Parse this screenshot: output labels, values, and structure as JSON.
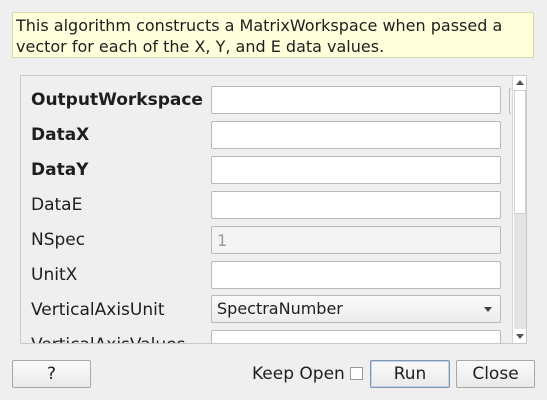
{
  "description": "This algorithm constructs a MatrixWorkspace when passed a\nvector for each of the X, Y, and E data values.",
  "properties": [
    {
      "label": "OutputWorkspace",
      "required": true,
      "value": ""
    },
    {
      "label": "DataX",
      "required": true,
      "value": ""
    },
    {
      "label": "DataY",
      "required": true,
      "value": ""
    },
    {
      "label": "DataE",
      "required": false,
      "value": ""
    },
    {
      "label": "NSpec",
      "required": false,
      "value": "",
      "placeholder": "1"
    },
    {
      "label": "UnitX",
      "required": false,
      "value": ""
    },
    {
      "label": "VerticalAxisUnit",
      "required": false,
      "selected": "SpectraNumber"
    },
    {
      "label": "VerticalAxisValues",
      "required": false,
      "value": ""
    }
  ],
  "buttons": {
    "help": "?",
    "keep_open": "Keep Open",
    "run": "Run",
    "close": "Close"
  }
}
